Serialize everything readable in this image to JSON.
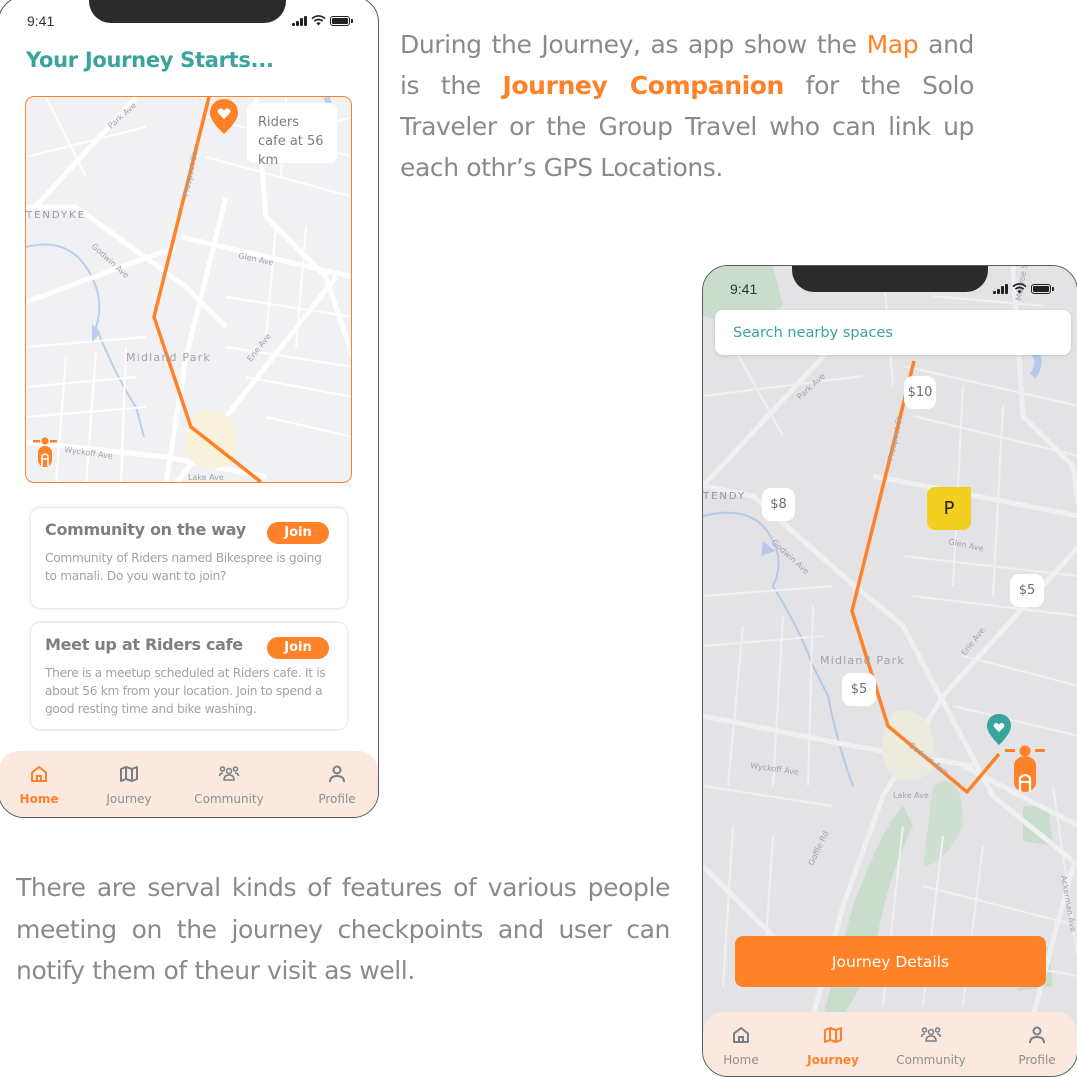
{
  "captions": {
    "top": {
      "part1": "During the Journey, as app show the ",
      "highlight1": "Map",
      "part2": " and is the ",
      "highlight2": "Journey Companion",
      "part3": " for the Solo Traveler or the Group Travel who can link up each othr’s GPS Locations."
    },
    "bottom": "There are serval kinds of features of various people meeting on the journey checkpoints and user can notify them of theur visit as well."
  },
  "home_screen": {
    "status_time": "9:41",
    "title": "Your Journey Starts...",
    "map": {
      "destination_label": "Riders cafe at 56 km",
      "place_labels": [
        "Park Ave",
        "Prospect St",
        "TENDYKE",
        "Godwin Ave",
        "Glen Ave",
        "Midland Park",
        "Erie Ave",
        "Wyckoff Ave",
        "Lake Ave"
      ]
    },
    "cards": [
      {
        "title": "Community on the way",
        "button": "Join",
        "body": "Community of Riders named Bikespree is going to manali. Do you want to join?"
      },
      {
        "title": "Meet up at Riders cafe",
        "button": "Join",
        "body": "There is a meetup scheduled at Riders cafe. It is about 56 km from your location. Join to spend a good resting time and bike washing."
      }
    ],
    "tabs": [
      {
        "label": "Home",
        "icon": "home-icon",
        "active": true
      },
      {
        "label": "Journey",
        "icon": "map-icon",
        "active": false
      },
      {
        "label": "Community",
        "icon": "community-icon",
        "active": false
      },
      {
        "label": "Profile",
        "icon": "profile-icon",
        "active": false
      }
    ]
  },
  "journey_screen": {
    "status_time": "9:41",
    "search_placeholder": "Search nearby spaces",
    "map": {
      "prices": [
        "$10",
        "$8",
        "$5",
        "$5"
      ],
      "parking_label": "P",
      "place_labels": [
        "Park Ave",
        "TENDY",
        "Godwin Ave",
        "Glen Ave",
        "Midland Park",
        "Erie Ave",
        "Wyckoff Ave",
        "Lake Ave",
        "Goffle Rd",
        "Ackerman Ave"
      ]
    },
    "details_button": "Journey Details",
    "tabs": [
      {
        "label": "Home",
        "icon": "home-icon",
        "active": false
      },
      {
        "label": "Journey",
        "icon": "map-icon",
        "active": true
      },
      {
        "label": "Community",
        "icon": "community-icon",
        "active": false
      },
      {
        "label": "Profile",
        "icon": "profile-icon",
        "active": false
      }
    ]
  },
  "colors": {
    "accent": "#ff8128",
    "teal": "#3aa39b",
    "parking": "#f3cf1f",
    "tabbar_bg": "#fbe8df",
    "text_gray": "#8a8a8a"
  }
}
